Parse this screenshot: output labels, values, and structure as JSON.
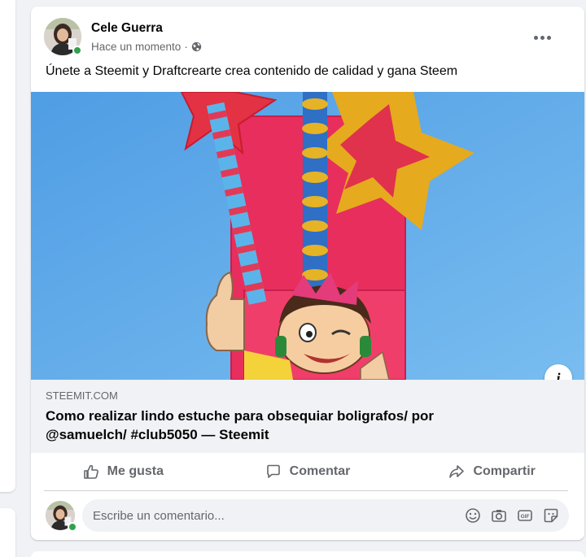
{
  "post": {
    "author": "Cele Guerra",
    "timestamp": "Hace un momento",
    "separator": "·",
    "privacy_icon": "globe-icon",
    "text": "Únete a Steemit y Draftcrearte crea contenido de calidad y gana Steem",
    "link": {
      "domain": "STEEMIT.COM",
      "title": "Como realizar lindo estuche para obsequiar boligrafos/ por @samuelch/ #club5050 — Steemit"
    },
    "info_label": "i"
  },
  "actions": {
    "like": "Me gusta",
    "comment": "Comentar",
    "share": "Compartir"
  },
  "comment": {
    "placeholder": "Escribe un comentario..."
  },
  "colors": {
    "online": "#31a24c",
    "muted": "#65676b",
    "background": "#f0f2f5",
    "photo_sky": "#5da9e9",
    "pink": "#e8285a",
    "gold": "#e7b021"
  }
}
